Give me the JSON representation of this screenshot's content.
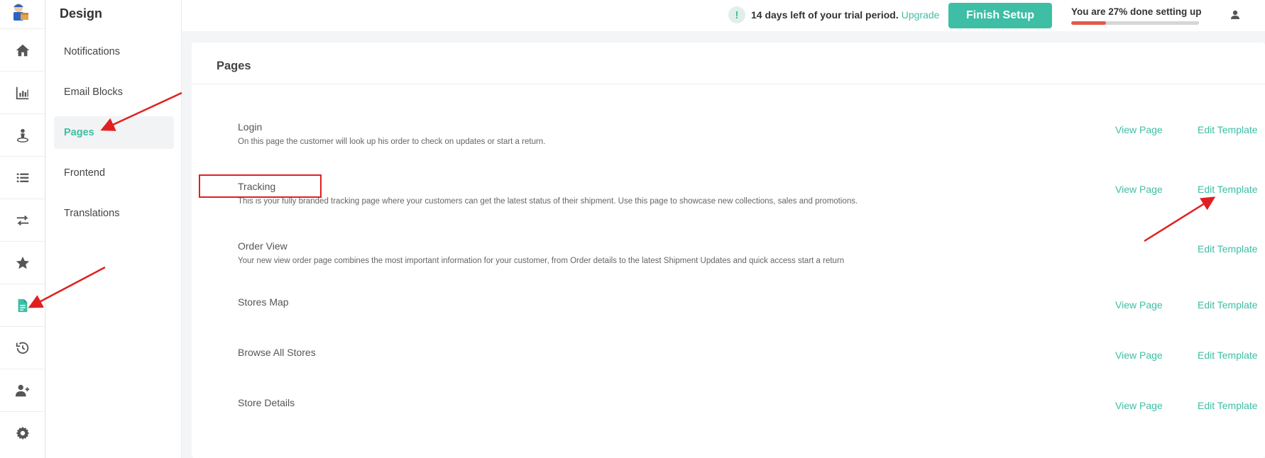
{
  "sidebar": {
    "title": "Design",
    "items": [
      {
        "label": "Notifications"
      },
      {
        "label": "Email Blocks"
      },
      {
        "label": "Pages"
      },
      {
        "label": "Frontend"
      },
      {
        "label": "Translations"
      }
    ],
    "active": "Pages"
  },
  "rail": {
    "icons": [
      "home-icon",
      "chart-icon",
      "map-pin-person-icon",
      "list-icon",
      "exchange-icon",
      "star-icon",
      "document-icon",
      "history-icon",
      "add-user-icon",
      "gear-icon"
    ],
    "active_icon": "document-icon"
  },
  "topbar": {
    "trial_icon": "!",
    "trial_text": "14 days left of your trial period.",
    "upgrade_label": "Upgrade",
    "finish_label": "Finish Setup",
    "progress_text": "You are 27% done setting up",
    "progress_value": 27
  },
  "main": {
    "title": "Pages",
    "view_label": "View Page",
    "edit_label": "Edit Template",
    "pages": [
      {
        "name": "Login",
        "description": "On this page the customer will look up his order to check on updates or start a return.",
        "has_view": true
      },
      {
        "name": "Tracking",
        "description": "This is your fully branded tracking page where your customers can get the latest status of their shipment. Use this page to showcase new collections, sales and promotions.",
        "has_view": true
      },
      {
        "name": "Order View",
        "description": "Your new view order page combines the most important information for your customer, from Order details to the latest Shipment Updates and quick access start a return",
        "has_view": false
      },
      {
        "name": "Stores Map",
        "description": "",
        "has_view": true
      },
      {
        "name": "Browse All Stores",
        "description": "",
        "has_view": true
      },
      {
        "name": "Store Details",
        "description": "",
        "has_view": true
      }
    ]
  },
  "colors": {
    "accent": "#3dbea5",
    "progress_fill": "#e25a4a",
    "annotation": "#e02020"
  }
}
